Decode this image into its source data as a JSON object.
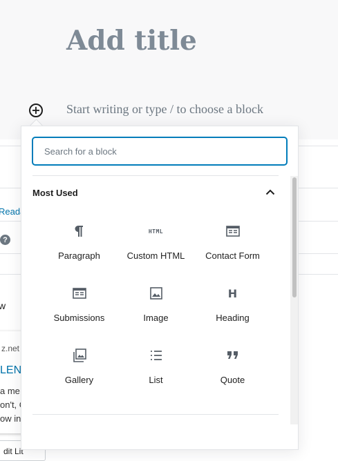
{
  "editor": {
    "title_placeholder": "Add title",
    "default_block_placeholder": "Start writing or type / to choose a block",
    "inserter_toggle_glyph": "+"
  },
  "background": {
    "sidebar_link": "Reada",
    "sidebar_text_partial": "w",
    "help_glyph": "?",
    "preview_domain_partial": "z.net",
    "preview_title_partial": "LEN",
    "preview_lines": [
      "a me",
      "on't, C",
      "ow in"
    ],
    "button_partial": "dit Lit"
  },
  "inserter": {
    "search_placeholder": "Search for a block",
    "panel_title": "Most Used",
    "panel_toggle_icon": "chevron-up-icon",
    "blocks": [
      {
        "label": "Paragraph",
        "icon": "paragraph-icon"
      },
      {
        "label": "Custom HTML",
        "icon": "html-icon",
        "icon_text": "HTML"
      },
      {
        "label": "Contact Form",
        "icon": "contact-form-icon"
      },
      {
        "label": "Submissions",
        "icon": "submissions-icon"
      },
      {
        "label": "Image",
        "icon": "image-icon"
      },
      {
        "label": "Heading",
        "icon": "heading-icon",
        "icon_text": "H"
      },
      {
        "label": "Gallery",
        "icon": "gallery-icon"
      },
      {
        "label": "List",
        "icon": "list-icon"
      },
      {
        "label": "Quote",
        "icon": "quote-icon"
      }
    ]
  },
  "colors": {
    "accent": "#007cba",
    "link": "#0073aa",
    "text": "#1e1e1e",
    "muted": "#6c7781",
    "title": "#7e8a96"
  }
}
